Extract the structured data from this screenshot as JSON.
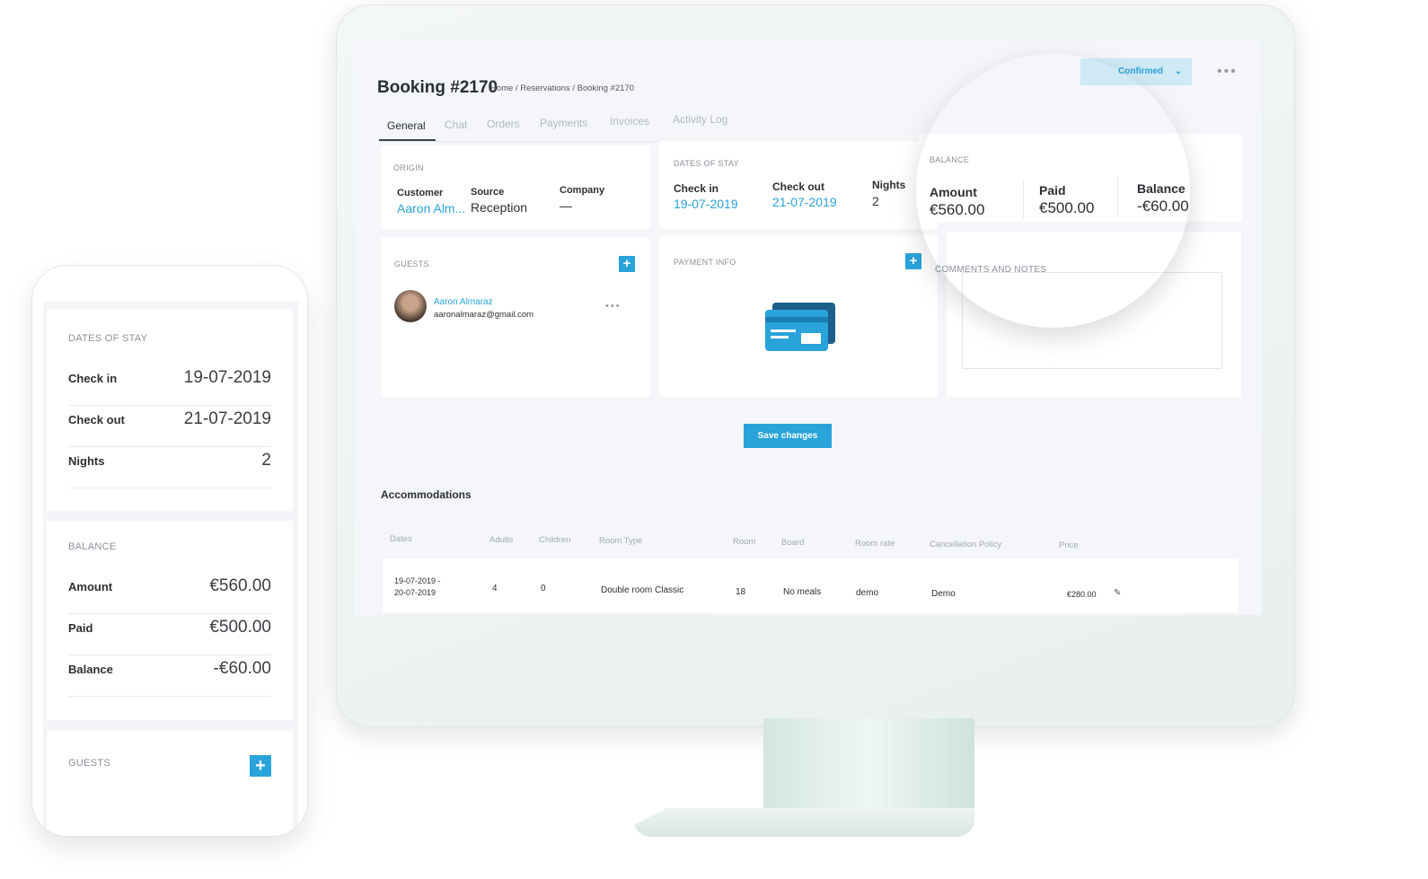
{
  "header": {
    "title": "Booking #2170",
    "breadcrumb": [
      "Home",
      "Reservations",
      "Booking #2170"
    ],
    "status": "Confirmed",
    "more": "•••"
  },
  "tabs": [
    "General",
    "Chat",
    "Orders",
    "Payments",
    "Invoices",
    "Activity Log"
  ],
  "origin": {
    "label": "ORIGIN",
    "customer_label": "Customer",
    "customer": "Aaron Alm...",
    "source_label": "Source",
    "source": "Reception",
    "company_label": "Company",
    "company": "—"
  },
  "dates": {
    "label": "DATES OF STAY",
    "checkin_label": "Check in",
    "checkin": "19-07-2019",
    "checkout_label": "Check out",
    "checkout": "21-07-2019",
    "nights_label": "Nights",
    "nights": "2"
  },
  "balance": {
    "label": "BALANCE",
    "amount_label": "Amount",
    "amount": "€560.00",
    "paid_label": "Paid",
    "paid": "€500.00",
    "balance_label": "Balance",
    "balance": "-€60.00"
  },
  "guests": {
    "label": "GUESTS",
    "name": "Aaron Almaraz",
    "email": "aaronalmaraz@gmail.com"
  },
  "payment": {
    "label": "PAYMENT INFO"
  },
  "comments": {
    "label": "COMMENTS AND NOTES"
  },
  "save_label": "Save changes",
  "accommodations": {
    "title": "Accommodations",
    "columns": [
      "Dates",
      "Adults",
      "Children",
      "Room Type",
      "Room",
      "Board",
      "Room rate",
      "Cancellation Policy",
      "Price"
    ],
    "rows": [
      {
        "dates1": "19-07-2019 -",
        "dates2": "20-07-2019",
        "adults": "4",
        "children": "0",
        "room_type": "Double room Classic",
        "room": "18",
        "board": "No meals",
        "rate": "demo",
        "policy": "Demo",
        "price": "€280.00"
      }
    ]
  },
  "colors": {
    "accent": "#29a3da"
  }
}
